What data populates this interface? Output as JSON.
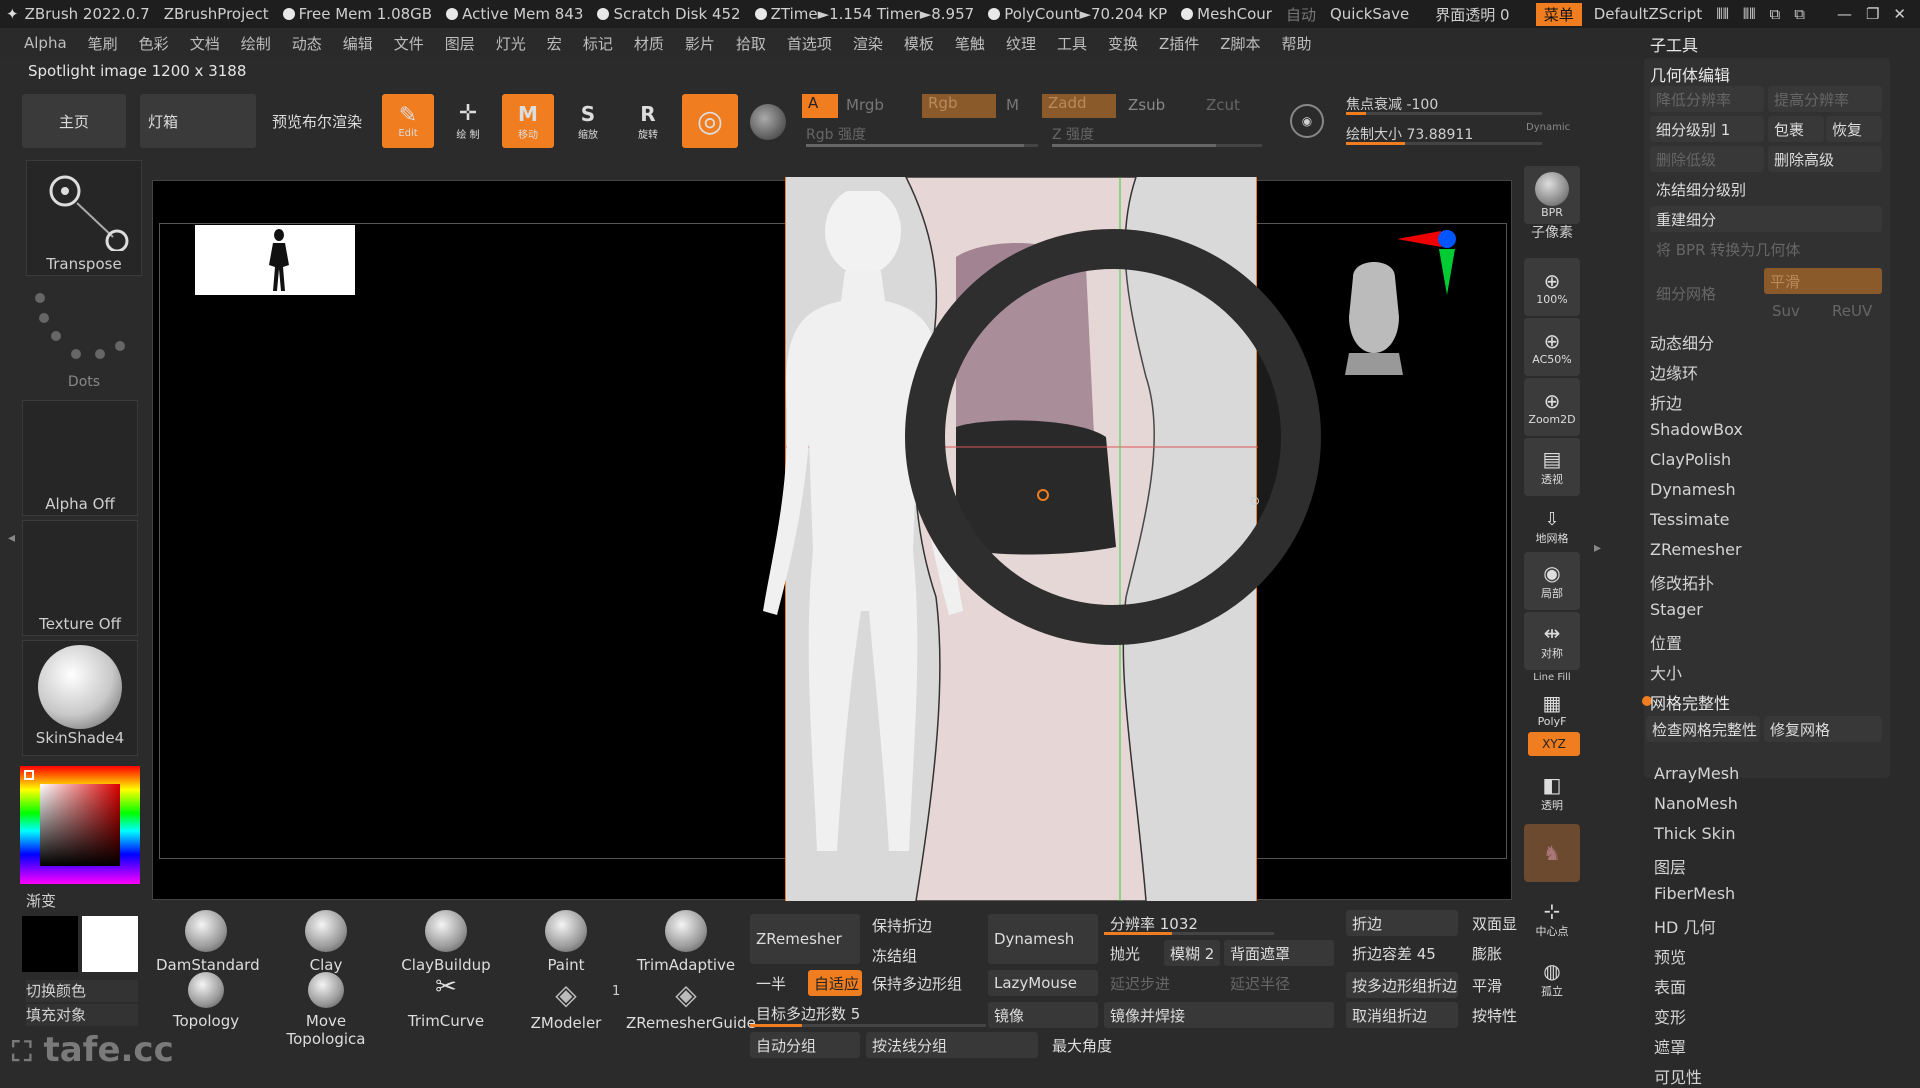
{
  "topbar": {
    "app": "ZBrush 2022.0.7",
    "project": "ZBrushProject",
    "free_mem": "Free Mem 1.08GB",
    "active_mem": "Active Mem 843",
    "scratch": "Scratch Disk 452",
    "ztime": "ZTime►1.154 Timer►8.957",
    "polycount": "PolyCount►70.204 KP",
    "meshcount": "MeshCour",
    "autosave": "自动",
    "quicksave": "QuickSave",
    "transparency": "界面透明 0",
    "menu": "菜单",
    "script": "DefaultZScript"
  },
  "menubar": [
    "Alpha",
    "笔刷",
    "色彩",
    "文档",
    "绘制",
    "动态",
    "编辑",
    "文件",
    "图层",
    "灯光",
    "宏",
    "标记",
    "材质",
    "影片",
    "拾取",
    "首选项",
    "渲染",
    "模板",
    "笔触",
    "纹理",
    "工具",
    "变换",
    "Z插件",
    "Z脚本",
    "帮助"
  ],
  "spotlight": "Spotlight image 1200 x 3188",
  "toolbar": {
    "home": "主页",
    "lightbox": "灯箱",
    "bpr": "预览布尔渲染",
    "edit": "Edit",
    "draw": "绘 制",
    "move": "移动",
    "scale": "缩放",
    "rotate": "旋转",
    "a_label": "A",
    "mrgb": "Mrgb",
    "rgb": "Rgb",
    "m": "M",
    "zadd": "Zadd",
    "zsub": "Zsub",
    "zcut": "Zcut",
    "rgb_intensity": "Rgb 强度",
    "z_intensity": "Z 强度",
    "focal_shift": "焦点衰减 -100",
    "draw_size": "绘制大小 73.88911",
    "dynamic": "Dynamic"
  },
  "left": {
    "transpose": "Transpose",
    "dots": "Dots",
    "alpha": "Alpha Off",
    "texture": "Texture Off",
    "material": "SkinShade4",
    "gradient": "渐变",
    "switch_color": "切换颜色",
    "fill_object": "填充对象"
  },
  "right_tools": [
    "BPR",
    "子像素",
    "100%",
    "AC50%",
    "Zoom2D",
    "透视",
    "地网格",
    "局部",
    "对称",
    "PolyF",
    "XYZ",
    "透明",
    "",
    "中心点",
    "孤立"
  ],
  "line_fill": "Line Fill",
  "rpanel": {
    "title": "子工具",
    "geom": "几何体编辑",
    "lower_res": "降低分辨率",
    "higher_res": "提高分辨率",
    "subdiv_level": "细分级别 1",
    "cage": "包裹",
    "restore": "恢复",
    "del_lower": "删除低级",
    "del_higher": "删除高级",
    "freeze_subdiv": "冻结细分级别",
    "reconstruct": "重建细分",
    "bpr_to_geo": "将 BPR 转换为几何体",
    "subdiv_grid": "细分网格",
    "smooth": "平滑",
    "suv": "Suv",
    "reuv": "ReUV",
    "items": [
      "动态细分",
      "边缘环",
      "折边",
      "ShadowBox",
      "ClayPolish",
      "Dynamesh",
      "Tessimate",
      "ZRemesher",
      "修改拓扑",
      "Stager",
      "位置",
      "大小"
    ],
    "mesh_integrity": "网格完整性",
    "check_mesh": "检查网格完整性",
    "fix_mesh": "修复网格",
    "items2": [
      "ArrayMesh",
      "NanoMesh",
      "Thick Skin",
      "图层",
      "FiberMesh",
      "HD 几何",
      "预览",
      "表面",
      "变形",
      "遮罩",
      "可见性"
    ]
  },
  "brushes": [
    "DamStandard",
    "Clay",
    "ClayBuildup",
    "Paint",
    "TrimAdaptive",
    "Topology",
    "Move Topologica",
    "TrimCurve",
    "ZModeler",
    "ZRemesherGuide"
  ],
  "zmodeler_count": "1",
  "bottom": {
    "zremesher": "ZRemesher",
    "keep_creases": "保持折边",
    "freeze_groups": "冻结组",
    "half": "一半",
    "adaptive": "自适应",
    "keep_polygroups": "保持多边形组",
    "target_poly": "目标多边形数 5",
    "auto_groups": "自动分组",
    "by_normal": "按法线分组",
    "dynamesh": "Dynamesh",
    "lazymouse": "LazyMouse",
    "mirror": "镜像",
    "resolution": "分辨率 1032",
    "polish": "抛光",
    "blur": "模糊 2",
    "backface": "背面遮罩",
    "lazy_step": "延迟步进",
    "lazy_radius": "延迟半径",
    "mirror_weld": "镜像并焊接",
    "max_angle": "最大角度",
    "crease": "折边",
    "double": "双面显",
    "crease_tol": "折边容差 45",
    "inflate": "膨胀",
    "crease_pg": "按多边形组折边",
    "smooth": "平滑",
    "uncrease": "取消组折边",
    "by_feature": "按特性"
  },
  "watermark": "tafe.cc"
}
